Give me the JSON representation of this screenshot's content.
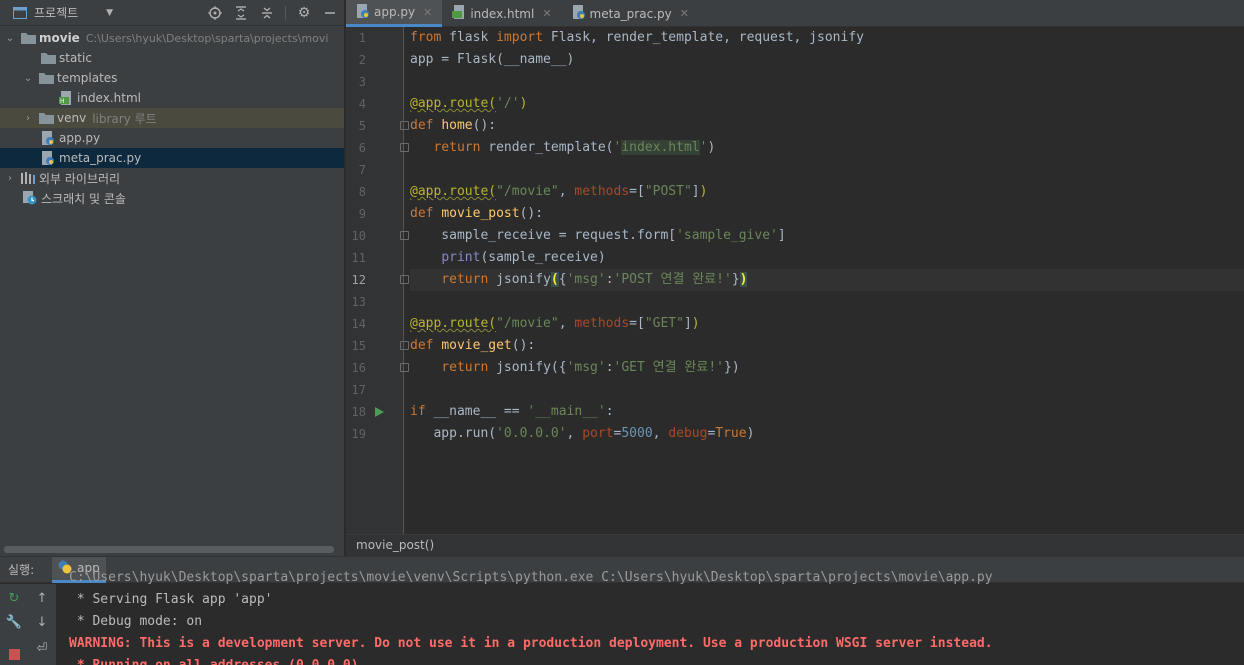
{
  "project": {
    "title": "프로젝트",
    "tree": [
      {
        "name": "movie",
        "path": "C:\\Users\\hyuk\\Desktop\\sparta\\projects\\movi"
      },
      {
        "name": "static"
      },
      {
        "name": "templates"
      },
      {
        "name": "index.html"
      },
      {
        "name": "venv",
        "suffix": "library 루트"
      },
      {
        "name": "app.py"
      },
      {
        "name": "meta_prac.py"
      },
      {
        "name": "외부 라이브러리"
      },
      {
        "name": "스크래치 및 콘솔"
      }
    ]
  },
  "tabs": [
    {
      "label": "app.py",
      "active": true
    },
    {
      "label": "index.html",
      "active": false
    },
    {
      "label": "meta_prac.py",
      "active": false
    }
  ],
  "editor": {
    "current_line": 12,
    "line_numbers": [
      "1",
      "2",
      "3",
      "4",
      "5",
      "6",
      "7",
      "8",
      "9",
      "10",
      "11",
      "12",
      "13",
      "14",
      "15",
      "16",
      "17",
      "18",
      "19"
    ]
  },
  "breadcrumb": "movie_post()",
  "run": {
    "label": "실행:",
    "tab": "app",
    "console": [
      "C:\\Users\\hyuk\\Desktop\\sparta\\projects\\movie\\venv\\Scripts\\python.exe C:\\Users\\hyuk\\Desktop\\sparta\\projects\\movie\\app.py",
      " * Serving Flask app 'app'",
      " * Debug mode: on",
      "WARNING: This is a development server. Do not use it in a production deployment. Use a production WSGI server instead.",
      " * Running on all addresses (0.0.0.0)"
    ]
  },
  "colors": {
    "accent": "#4a88c7",
    "keyword": "#cc7832",
    "string": "#6a8759",
    "decorator": "#bbb529",
    "function": "#ffc66d",
    "error": "#ff6b68"
  }
}
